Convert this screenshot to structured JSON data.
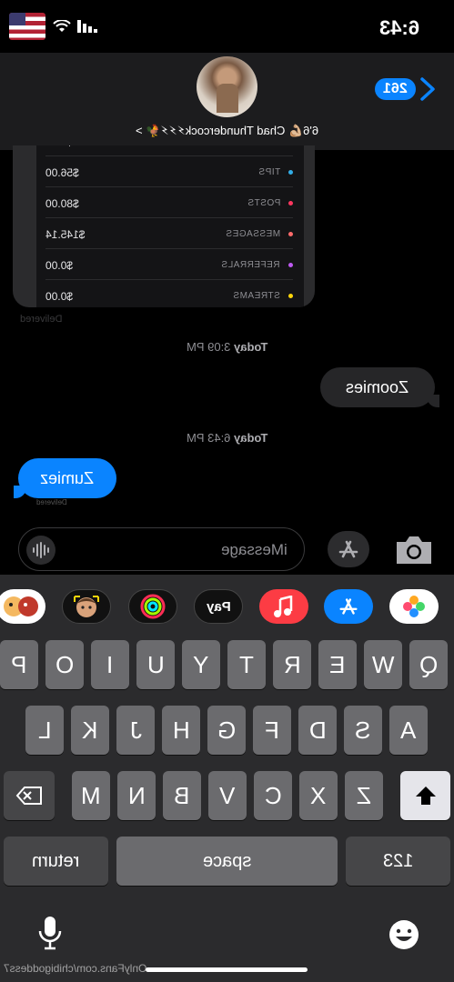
{
  "status": {
    "time": "6:43"
  },
  "header": {
    "back_count": "261",
    "contact_name": "6'6💪🏼 Chad Thundercock⚡⚡⚡🐓 >"
  },
  "earnings_card": {
    "rows": [
      {
        "label": "TIPS",
        "amount": "$56.00",
        "color": "#32ade6"
      },
      {
        "label": "POSTS",
        "amount": "$80.00",
        "color": "#ff375f"
      },
      {
        "label": "MESSAGES",
        "amount": "$145.14",
        "color": "#ff6b6b"
      },
      {
        "label": "REFERRALS",
        "amount": "$0.00",
        "color": "#bf5af2"
      },
      {
        "label": "STREAMS",
        "amount": "$0.00",
        "color": "#ffd60a"
      }
    ],
    "caption": "Delivered"
  },
  "messages": {
    "ts1_day": "Today",
    "ts1_time": "3:09 PM",
    "sent_text": "Zoomies",
    "ts2_day": "Today",
    "ts2_time": "6:43 PM",
    "reply_text": "Zumiez",
    "reply_status": "Delivered"
  },
  "input": {
    "placeholder": "iMessage"
  },
  "app_drawer": [
    "photos-icon",
    "appstore-icon",
    "music-icon",
    "applepay-icon",
    "activity-icon",
    "memoji-icon",
    "animoji-icon"
  ],
  "apple_pay_label": "Pay",
  "keyboard": {
    "row1": [
      "Q",
      "W",
      "E",
      "R",
      "T",
      "Y",
      "U",
      "I",
      "O",
      "P"
    ],
    "row2": [
      "A",
      "S",
      "D",
      "F",
      "G",
      "H",
      "J",
      "K",
      "L"
    ],
    "row3": [
      "Z",
      "X",
      "C",
      "V",
      "B",
      "N",
      "M"
    ],
    "numbers": "123",
    "space": "space",
    "return": "return"
  },
  "watermark": "OnlyFans.com/chibigoddess7"
}
